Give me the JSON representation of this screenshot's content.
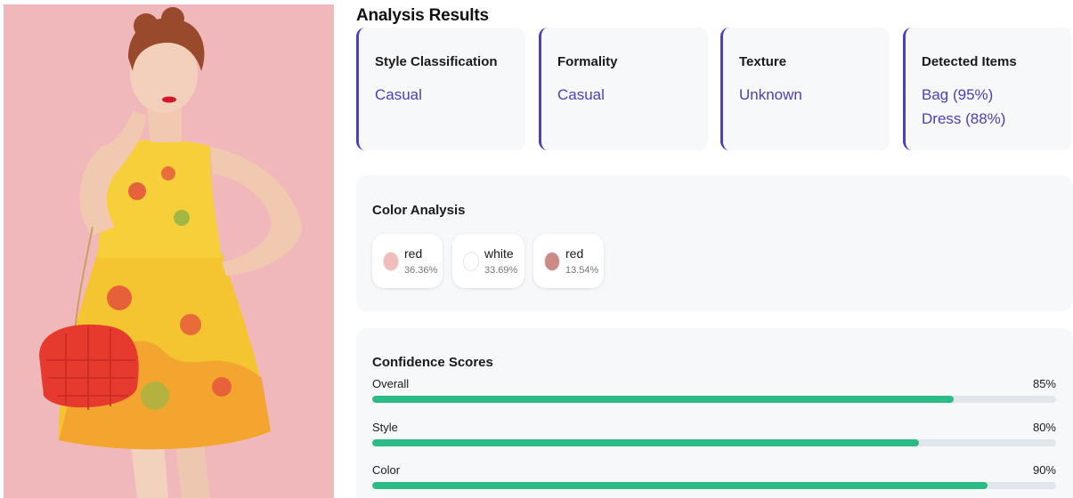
{
  "photo": {
    "description_icon": "fashion-photo",
    "background_color": "#f1b8bc"
  },
  "results": {
    "title": "Analysis Results",
    "cards": [
      {
        "label": "Style Classification",
        "values": [
          "Casual"
        ]
      },
      {
        "label": "Formality",
        "values": [
          "Casual"
        ]
      },
      {
        "label": "Texture",
        "values": [
          "Unknown"
        ]
      },
      {
        "label": "Detected Items",
        "values": [
          "Bag (95%)",
          "Dress (88%)"
        ]
      }
    ],
    "accent_color": "#4a3fb8"
  },
  "color_analysis": {
    "title": "Color Analysis",
    "colors": [
      {
        "name": "red",
        "percent": "36.36%",
        "swatch": "#f1bcbc"
      },
      {
        "name": "white",
        "percent": "33.69%",
        "swatch": "#ffffff"
      },
      {
        "name": "red",
        "percent": "13.54%",
        "swatch": "#cc8a84"
      }
    ]
  },
  "confidence": {
    "title": "Confidence Scores",
    "bar_color": "#2dbb85",
    "scores": [
      {
        "label": "Overall",
        "percent_text": "85%",
        "value": 0.85
      },
      {
        "label": "Style",
        "percent_text": "80%",
        "value": 0.8
      },
      {
        "label": "Color",
        "percent_text": "90%",
        "value": 0.9
      }
    ]
  }
}
